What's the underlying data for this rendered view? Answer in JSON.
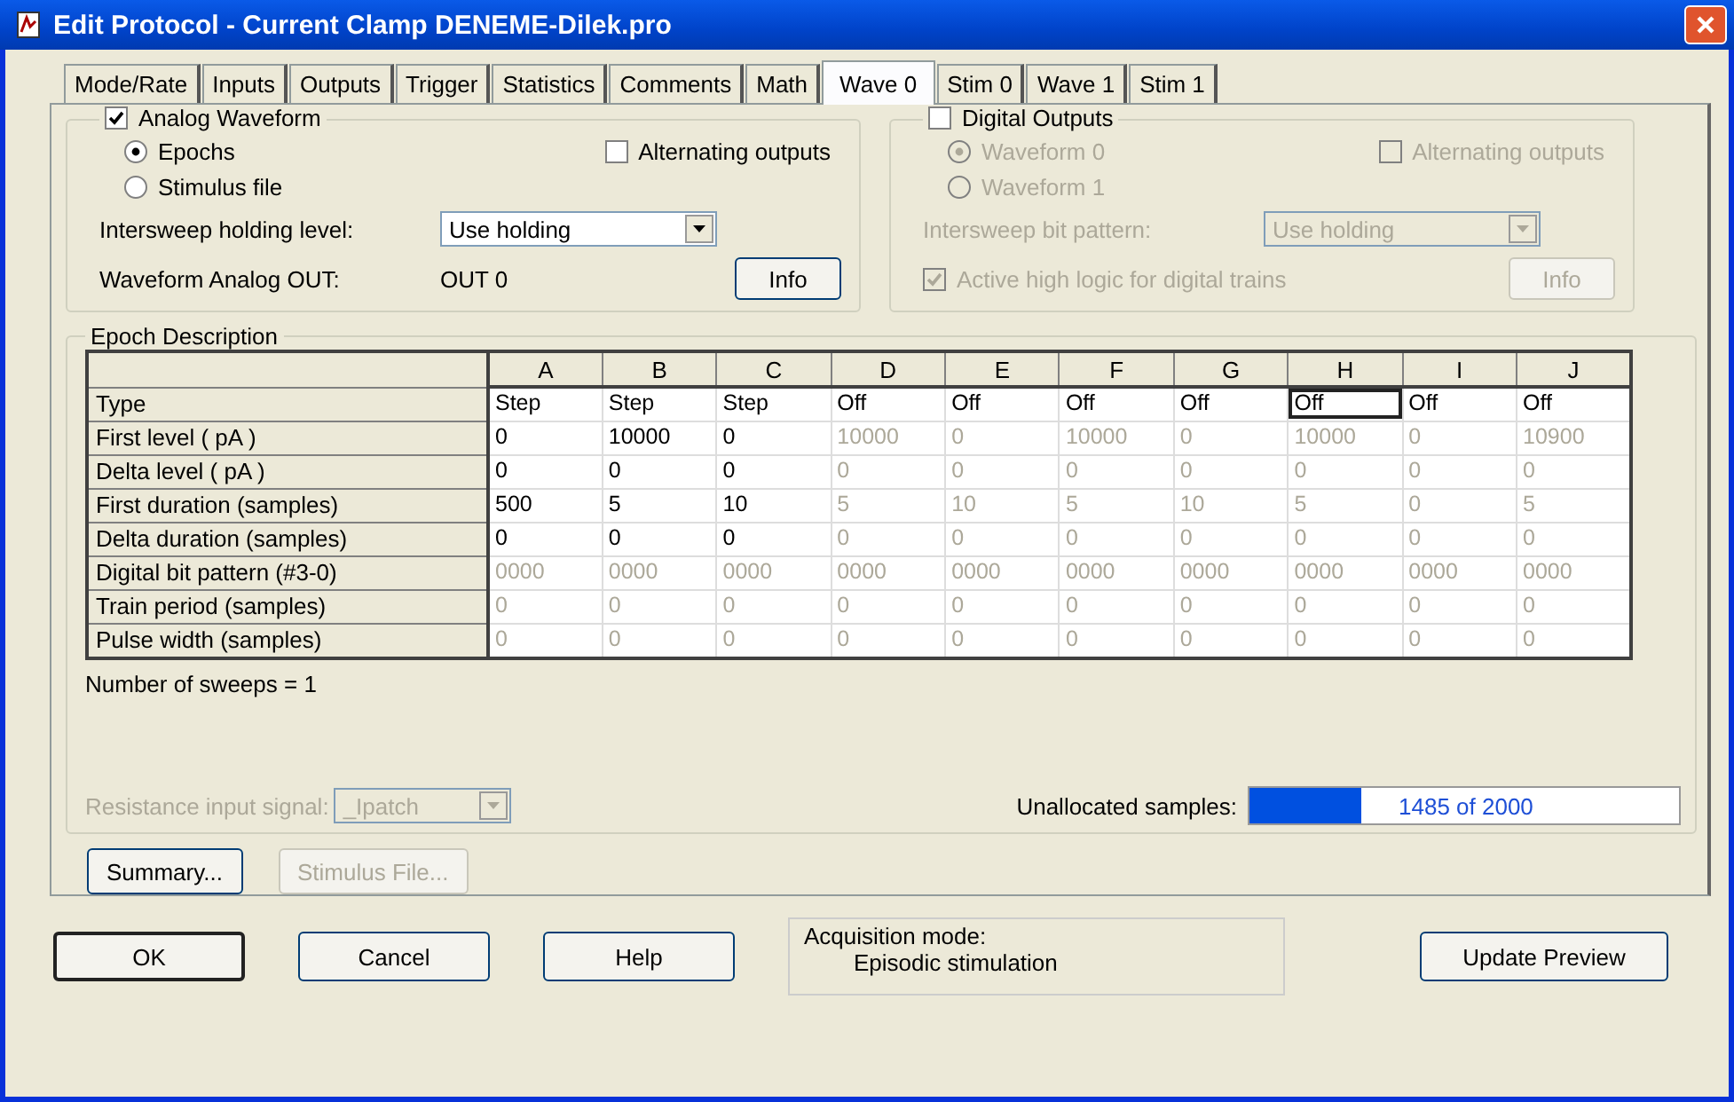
{
  "window": {
    "title": "Edit Protocol - Current Clamp DENEME-Dilek.pro"
  },
  "tabs": [
    {
      "label": "Mode/Rate",
      "selected": false
    },
    {
      "label": "Inputs",
      "selected": false
    },
    {
      "label": "Outputs",
      "selected": false
    },
    {
      "label": "Trigger",
      "selected": false
    },
    {
      "label": "Statistics",
      "selected": false
    },
    {
      "label": "Comments",
      "selected": false
    },
    {
      "label": "Math",
      "selected": false
    },
    {
      "label": "Wave 0",
      "selected": true
    },
    {
      "label": "Stim 0",
      "selected": false
    },
    {
      "label": "Wave 1",
      "selected": false
    },
    {
      "label": "Stim 1",
      "selected": false
    }
  ],
  "analog": {
    "label": "Analog Waveform",
    "checked": true,
    "options": [
      {
        "label": "Epochs",
        "selected": true
      },
      {
        "label": "Stimulus file",
        "selected": false
      }
    ],
    "alternating": {
      "label": "Alternating outputs",
      "checked": false
    },
    "holding_label": "Intersweep holding level:",
    "holding_value": "Use holding",
    "out_label": "Waveform Analog OUT:",
    "out_value": "OUT 0",
    "info": "Info"
  },
  "digital": {
    "label": "Digital Outputs",
    "checked": false,
    "options": [
      {
        "label": "Waveform 0",
        "selected": true,
        "disabled": true
      },
      {
        "label": "Waveform 1",
        "selected": false,
        "disabled": true
      }
    ],
    "alternating": {
      "label": "Alternating outputs",
      "checked": false,
      "disabled": true
    },
    "holding_label": "Intersweep bit pattern:",
    "holding_value": "Use holding",
    "active_high": {
      "label": "Active high logic for digital trains",
      "checked": true,
      "disabled": true
    },
    "info": "Info"
  },
  "epoch": {
    "title": "Epoch Description",
    "columns": [
      "A",
      "B",
      "C",
      "D",
      "E",
      "F",
      "G",
      "H",
      "I",
      "J"
    ],
    "rows": [
      {
        "label": "Type",
        "cells": [
          {
            "text": "Step",
            "disabled": false,
            "selected": false
          },
          {
            "text": "Step",
            "disabled": false,
            "selected": false
          },
          {
            "text": "Step",
            "disabled": false,
            "selected": false
          },
          {
            "text": "Off",
            "disabled": false,
            "selected": false
          },
          {
            "text": "Off",
            "disabled": false,
            "selected": false
          },
          {
            "text": "Off",
            "disabled": false,
            "selected": false
          },
          {
            "text": "Off",
            "disabled": false,
            "selected": false
          },
          {
            "text": "Off",
            "disabled": false,
            "selected": true
          },
          {
            "text": "Off",
            "disabled": false,
            "selected": false
          },
          {
            "text": "Off",
            "disabled": false,
            "selected": false
          }
        ]
      },
      {
        "label": "First level ( pA )",
        "cells": [
          {
            "text": "0",
            "disabled": false,
            "selected": false
          },
          {
            "text": "10000",
            "disabled": false,
            "selected": false
          },
          {
            "text": "0",
            "disabled": false,
            "selected": false
          },
          {
            "text": "10000",
            "disabled": true,
            "selected": false
          },
          {
            "text": "0",
            "disabled": true,
            "selected": false
          },
          {
            "text": "10000",
            "disabled": true,
            "selected": false
          },
          {
            "text": "0",
            "disabled": true,
            "selected": false
          },
          {
            "text": "10000",
            "disabled": true,
            "selected": false
          },
          {
            "text": "0",
            "disabled": true,
            "selected": false
          },
          {
            "text": "10900",
            "disabled": true,
            "selected": false
          }
        ]
      },
      {
        "label": "Delta level ( pA )",
        "cells": [
          {
            "text": "0",
            "disabled": false,
            "selected": false
          },
          {
            "text": "0",
            "disabled": false,
            "selected": false
          },
          {
            "text": "0",
            "disabled": false,
            "selected": false
          },
          {
            "text": "0",
            "disabled": true,
            "selected": false
          },
          {
            "text": "0",
            "disabled": true,
            "selected": false
          },
          {
            "text": "0",
            "disabled": true,
            "selected": false
          },
          {
            "text": "0",
            "disabled": true,
            "selected": false
          },
          {
            "text": "0",
            "disabled": true,
            "selected": false
          },
          {
            "text": "0",
            "disabled": true,
            "selected": false
          },
          {
            "text": "0",
            "disabled": true,
            "selected": false
          }
        ]
      },
      {
        "label": "First duration (samples)",
        "cells": [
          {
            "text": "500",
            "disabled": false,
            "selected": false
          },
          {
            "text": "5",
            "disabled": false,
            "selected": false
          },
          {
            "text": "10",
            "disabled": false,
            "selected": false
          },
          {
            "text": "5",
            "disabled": true,
            "selected": false
          },
          {
            "text": "10",
            "disabled": true,
            "selected": false
          },
          {
            "text": "5",
            "disabled": true,
            "selected": false
          },
          {
            "text": "10",
            "disabled": true,
            "selected": false
          },
          {
            "text": "5",
            "disabled": true,
            "selected": false
          },
          {
            "text": "0",
            "disabled": true,
            "selected": false
          },
          {
            "text": "5",
            "disabled": true,
            "selected": false
          }
        ]
      },
      {
        "label": "Delta duration (samples)",
        "cells": [
          {
            "text": "0",
            "disabled": false,
            "selected": false
          },
          {
            "text": "0",
            "disabled": false,
            "selected": false
          },
          {
            "text": "0",
            "disabled": false,
            "selected": false
          },
          {
            "text": "0",
            "disabled": true,
            "selected": false
          },
          {
            "text": "0",
            "disabled": true,
            "selected": false
          },
          {
            "text": "0",
            "disabled": true,
            "selected": false
          },
          {
            "text": "0",
            "disabled": true,
            "selected": false
          },
          {
            "text": "0",
            "disabled": true,
            "selected": false
          },
          {
            "text": "0",
            "disabled": true,
            "selected": false
          },
          {
            "text": "0",
            "disabled": true,
            "selected": false
          }
        ]
      },
      {
        "label": "Digital bit pattern (#3-0)",
        "cells": [
          {
            "text": "0000",
            "disabled": true,
            "selected": false
          },
          {
            "text": "0000",
            "disabled": true,
            "selected": false
          },
          {
            "text": "0000",
            "disabled": true,
            "selected": false
          },
          {
            "text": "0000",
            "disabled": true,
            "selected": false
          },
          {
            "text": "0000",
            "disabled": true,
            "selected": false
          },
          {
            "text": "0000",
            "disabled": true,
            "selected": false
          },
          {
            "text": "0000",
            "disabled": true,
            "selected": false
          },
          {
            "text": "0000",
            "disabled": true,
            "selected": false
          },
          {
            "text": "0000",
            "disabled": true,
            "selected": false
          },
          {
            "text": "0000",
            "disabled": true,
            "selected": false
          }
        ]
      },
      {
        "label": "Train period (samples)",
        "cells": [
          {
            "text": "0",
            "disabled": true,
            "selected": false
          },
          {
            "text": "0",
            "disabled": true,
            "selected": false
          },
          {
            "text": "0",
            "disabled": true,
            "selected": false
          },
          {
            "text": "0",
            "disabled": true,
            "selected": false
          },
          {
            "text": "0",
            "disabled": true,
            "selected": false
          },
          {
            "text": "0",
            "disabled": true,
            "selected": false
          },
          {
            "text": "0",
            "disabled": true,
            "selected": false
          },
          {
            "text": "0",
            "disabled": true,
            "selected": false
          },
          {
            "text": "0",
            "disabled": true,
            "selected": false
          },
          {
            "text": "0",
            "disabled": true,
            "selected": false
          }
        ]
      },
      {
        "label": "Pulse width (samples)",
        "cells": [
          {
            "text": "0",
            "disabled": true,
            "selected": false
          },
          {
            "text": "0",
            "disabled": true,
            "selected": false
          },
          {
            "text": "0",
            "disabled": true,
            "selected": false
          },
          {
            "text": "0",
            "disabled": true,
            "selected": false
          },
          {
            "text": "0",
            "disabled": true,
            "selected": false
          },
          {
            "text": "0",
            "disabled": true,
            "selected": false
          },
          {
            "text": "0",
            "disabled": true,
            "selected": false
          },
          {
            "text": "0",
            "disabled": true,
            "selected": false
          },
          {
            "text": "0",
            "disabled": true,
            "selected": false
          },
          {
            "text": "0",
            "disabled": true,
            "selected": false
          }
        ]
      }
    ],
    "sweeps": "Number of sweeps = 1",
    "resistance_label": "Resistance input signal:",
    "resistance_value": "_Ipatch",
    "resistance_disabled": true,
    "unallocated_label": "Unallocated samples:",
    "unallocated": {
      "level": 0.26,
      "reading": "1485 of 2000"
    }
  },
  "panel_buttons": [
    {
      "label": "Summary...",
      "disabled": false
    },
    {
      "label": "Stimulus File...",
      "disabled": true
    }
  ],
  "buttons": [
    {
      "label": "OK",
      "default": true
    },
    {
      "label": "Cancel",
      "default": false
    },
    {
      "label": "Help",
      "default": false
    }
  ],
  "acquisition": {
    "label": "Acquisition mode:",
    "value": "Episodic stimulation"
  },
  "update_button": "Update Preview"
}
